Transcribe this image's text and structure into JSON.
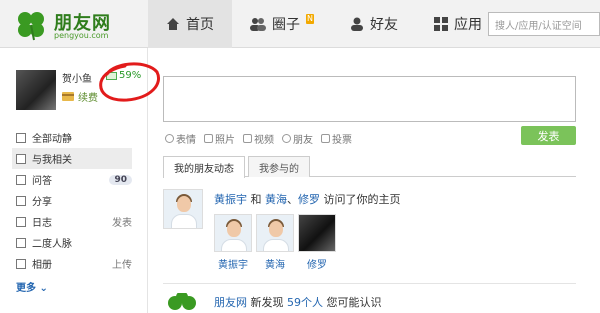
{
  "header": {
    "logo_title": "朋友网",
    "logo_subtitle": "pengyou.com",
    "nav": [
      {
        "label": "首页",
        "icon": "home-icon"
      },
      {
        "label": "圈子",
        "icon": "people-icon",
        "badge": "N"
      },
      {
        "label": "好友",
        "icon": "person-icon"
      },
      {
        "label": "应用",
        "icon": "apps-grid-icon"
      }
    ],
    "search_placeholder": "搜人/应用/认证空间"
  },
  "profile": {
    "name": "贺小鱼",
    "vip_percent": "59%",
    "task_label": "续费"
  },
  "sidebar": {
    "items": [
      {
        "label": "全部动静",
        "right": ""
      },
      {
        "label": "与我相关",
        "right": ""
      },
      {
        "label": "问答",
        "count": "90"
      },
      {
        "label": "分享",
        "right": ""
      },
      {
        "label": "日志",
        "right": "发表"
      },
      {
        "label": "二度人脉",
        "right": ""
      },
      {
        "label": "相册",
        "right": "上传"
      }
    ],
    "more_label": "更多"
  },
  "composer": {
    "tools": [
      {
        "label": "表情",
        "icon": "smile-icon"
      },
      {
        "label": "照片",
        "icon": "camera-icon"
      },
      {
        "label": "视频",
        "icon": "video-icon"
      },
      {
        "label": "朋友",
        "icon": "at-icon"
      },
      {
        "label": "投票",
        "icon": "poll-icon"
      }
    ],
    "publish_label": "发表"
  },
  "feed_tabs": [
    "我的朋友动态",
    "我参与的"
  ],
  "feed": {
    "item1": {
      "actor": "黄振宇",
      "joiner": "和",
      "friend_a": "黄海",
      "sep": "、",
      "friend_b": "修罗",
      "action": "访问了你的主页",
      "visitors": [
        "黄振宇",
        "黄海",
        "修罗"
      ]
    },
    "item2": {
      "actor": "朋友网",
      "text_a": "新发现",
      "count_text": "59个人",
      "text_b": "您可能认识"
    }
  },
  "colors": {
    "brand_green": "#2f7d1c",
    "link_blue": "#2466b0",
    "publish_green": "#7bc35a",
    "annotation_red": "#e21b1b"
  }
}
